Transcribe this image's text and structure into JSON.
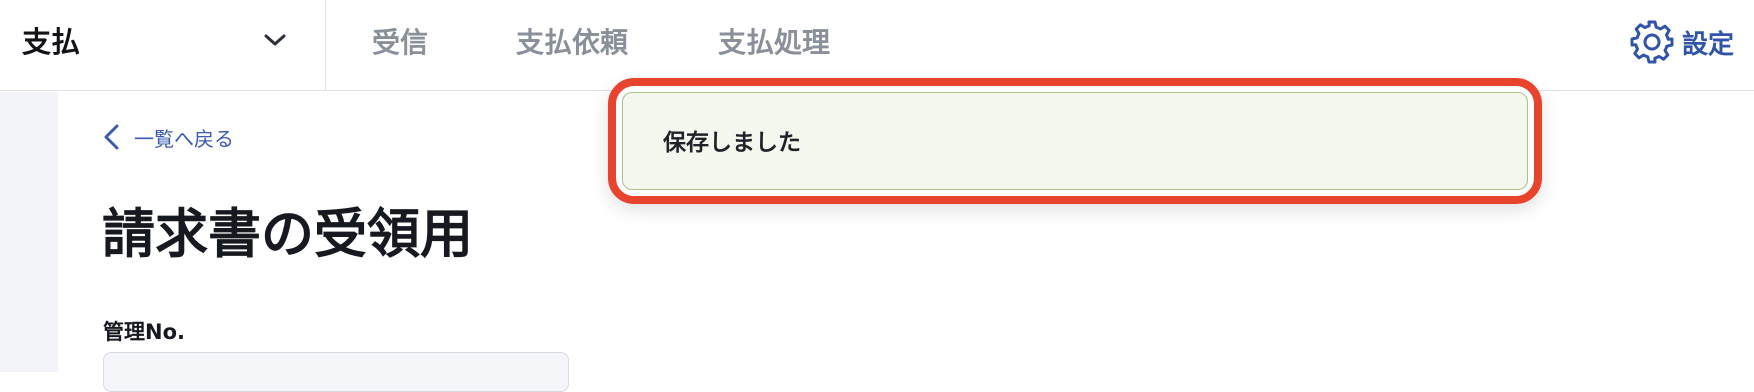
{
  "header": {
    "app_name": "支払",
    "tabs": [
      {
        "label": "受信"
      },
      {
        "label": "支払依頼"
      },
      {
        "label": "支払処理"
      }
    ],
    "settings_label": "設定"
  },
  "main": {
    "back_link": "一覧へ戻る",
    "page_title": "請求書の受領用",
    "field_label": "管理No."
  },
  "toast": {
    "message": "保存しました"
  },
  "colors": {
    "accent": "#2f54a8",
    "highlight_border": "#e8432c",
    "toast_background": "#f3f7ee"
  }
}
